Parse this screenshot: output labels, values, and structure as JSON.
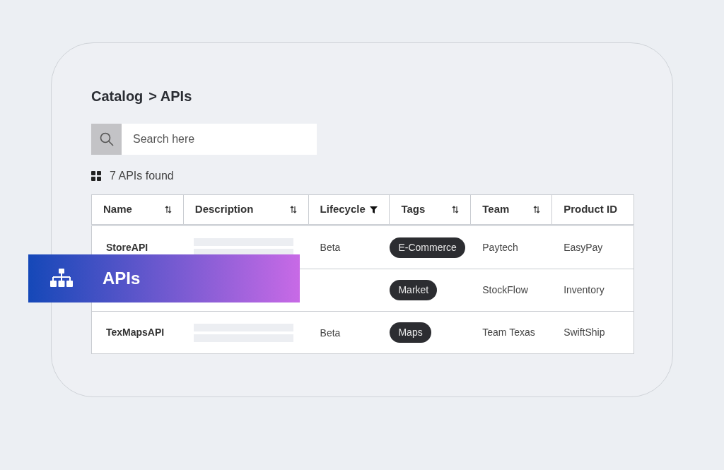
{
  "breadcrumb": {
    "root": "Catalog",
    "current": "> APIs"
  },
  "search": {
    "placeholder": "Search here"
  },
  "result_count": "7 APIs found",
  "table": {
    "columns": [
      {
        "label": "Name",
        "kind": "sort"
      },
      {
        "label": "Description",
        "kind": "sort"
      },
      {
        "label": "Lifecycle",
        "kind": "filter"
      },
      {
        "label": "Tags",
        "kind": "sort"
      },
      {
        "label": "Team",
        "kind": "sort"
      },
      {
        "label": "Product ID",
        "kind": "plain"
      }
    ],
    "rows": [
      {
        "name": "StoreAPI",
        "lifecycle": "Beta",
        "tag": "E-Commerce",
        "team": "Paytech",
        "product_id": "EasyPay"
      },
      {
        "tag": "Market",
        "team": "StockFlow",
        "product_id": "Inventory"
      },
      {
        "name": "TexMapsAPI",
        "lifecycle": "Beta",
        "tag": "Maps",
        "team": "Team Texas",
        "product_id": "SwiftShip"
      }
    ]
  },
  "banner": {
    "label": "APIs"
  }
}
